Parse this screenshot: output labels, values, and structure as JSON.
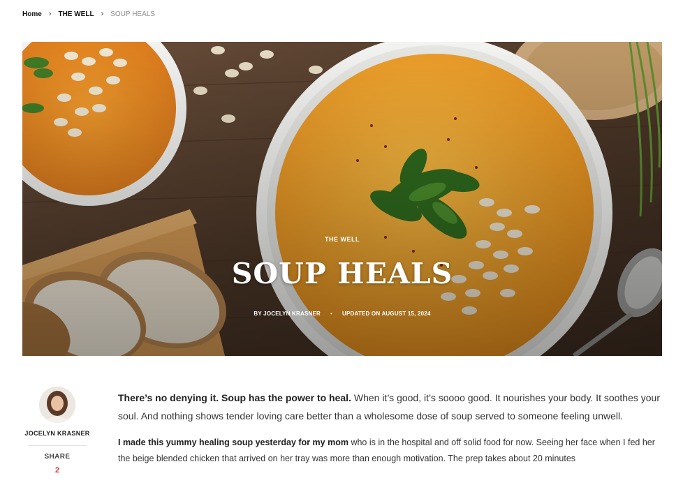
{
  "breadcrumb": {
    "home": "Home",
    "section": "THE WELL",
    "current": "SOUP HEALS"
  },
  "hero": {
    "category": "THE WELL",
    "title": "SOUP HEALS",
    "byline": "BY JOCELYN KRASNER",
    "updated": "UPDATED ON AUGUST 15, 2024"
  },
  "author": {
    "name": "JOCELYN KRASNER",
    "share_label": "SHARE",
    "share_count": "2"
  },
  "article": {
    "lead_bold": "There’s no denying it. Soup has the power to heal.",
    "lead_rest": " When it’s good, it’s soooo good. It nourishes your body. It soothes your soul. And nothing shows tender loving care better than a wholesome dose of soup served to someone feeling unwell.",
    "para_bold": "I made this yummy healing soup yesterday for my mom",
    "para_rest": " who is in the hospital and off solid food for now. Seeing her face when I fed her the beige blended chicken that arrived on her tray was more than enough motivation. The prep takes about 20 minutes"
  },
  "colors": {
    "soup": "#f0a52e",
    "wood": "#5a4231",
    "share_count": "#dd3333"
  }
}
